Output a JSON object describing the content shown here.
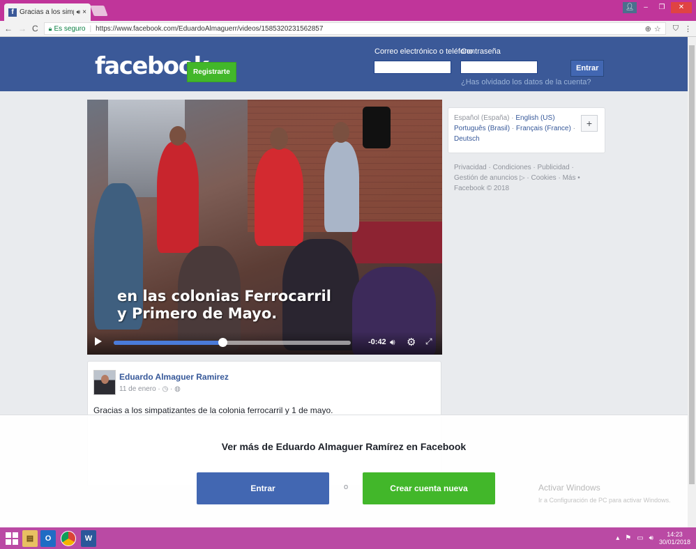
{
  "browser": {
    "tab_title": "Gracias a los simpatiz",
    "tab_audio_icon": "speaker-icon",
    "tab_close": "×",
    "secure_label": "Es seguro",
    "url": "https://www.facebook.com/EduardoAlmaguerr/videos/1585320231562857"
  },
  "header": {
    "logo": "facebook",
    "register_button": "Registrarte",
    "email_label": "Correo electrónico o teléfono",
    "password_label": "Contraseña",
    "login_button": "Entrar",
    "forgot_link": "¿Has olvidado los datos de la cuenta?"
  },
  "video": {
    "caption_line1": "en las colonias Ferrocarril",
    "caption_line2": "y Primero de Mayo.",
    "time_remaining": "-0:42",
    "progress_fraction": 0.46
  },
  "post": {
    "author": "Eduardo Almaguer Ramirez",
    "date": "11 de enero",
    "text": "Gracias a los simpatizantes de la colonia ferrocarril y 1 de mayo."
  },
  "languages": {
    "current": "Español (España)",
    "options": [
      "English (US)",
      "Português (Brasil)",
      "Français (France)",
      "Deutsch"
    ],
    "more": "+"
  },
  "footer": {
    "links": [
      "Privacidad",
      "Condiciones",
      "Publicidad",
      "Gestión de anuncios",
      "Cookies",
      "Más"
    ],
    "copyright": "Facebook © 2018"
  },
  "overlay": {
    "title": "Ver más de Eduardo Almaguer Ramírez en Facebook",
    "login_button": "Entrar",
    "or": "o",
    "create_button": "Crear cuenta nueva"
  },
  "windows": {
    "activate_title": "Activar Windows",
    "activate_sub": "Ir a Configuración de PC para activar Windows.",
    "time": "14:23",
    "date": "30/01/2018"
  },
  "colors": {
    "facebook_blue": "#3b5998",
    "button_blue": "#4267b2",
    "green": "#42b72a",
    "taskbar": "#ba4aa4"
  }
}
